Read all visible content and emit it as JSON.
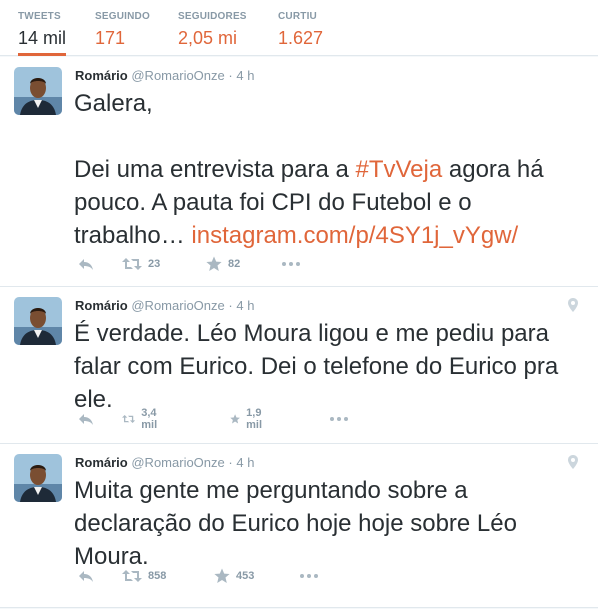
{
  "stats": [
    {
      "label": "TWEETS",
      "value": "14 mil"
    },
    {
      "label": "SEGUINDO",
      "value": "171"
    },
    {
      "label": "SEGUIDORES",
      "value": "2,05 mi"
    },
    {
      "label": "CURTIU",
      "value": "1.627"
    }
  ],
  "tweets": [
    {
      "name": "Romário",
      "handle": "@RomarioOnze",
      "time": "4 h",
      "line1": "Galera,",
      "line2_pre": "Dei uma entrevista para a ",
      "hashtag": "#TvVeja",
      "line2_post": " agora há pouco. A pauta foi CPI do Futebol e o trabalho… ",
      "link": "instagram.com/p/4SY1j_vYgw/",
      "retweets": "23",
      "favorites": "82"
    },
    {
      "name": "Romário",
      "handle": "@RomarioOnze",
      "time": "4 h",
      "text": "É verdade. Léo Moura ligou e me pediu para falar com Eurico. Dei o telefone do Eurico pra ele.",
      "retweets": "3,4 mil",
      "favorites": "1,9 mil"
    },
    {
      "name": "Romário",
      "handle": "@RomarioOnze",
      "time": "4 h",
      "text": "Muita gente me perguntando sobre a declaração do Eurico hoje hoje sobre Léo Moura.",
      "retweets": "858",
      "favorites": "453"
    }
  ],
  "colors": {
    "accent": "#e0663a",
    "muted": "#8899a6",
    "text": "#292f33"
  },
  "icons": [
    "reply-icon",
    "retweet-icon",
    "favorite-icon",
    "more-icon",
    "geo-location-icon"
  ]
}
